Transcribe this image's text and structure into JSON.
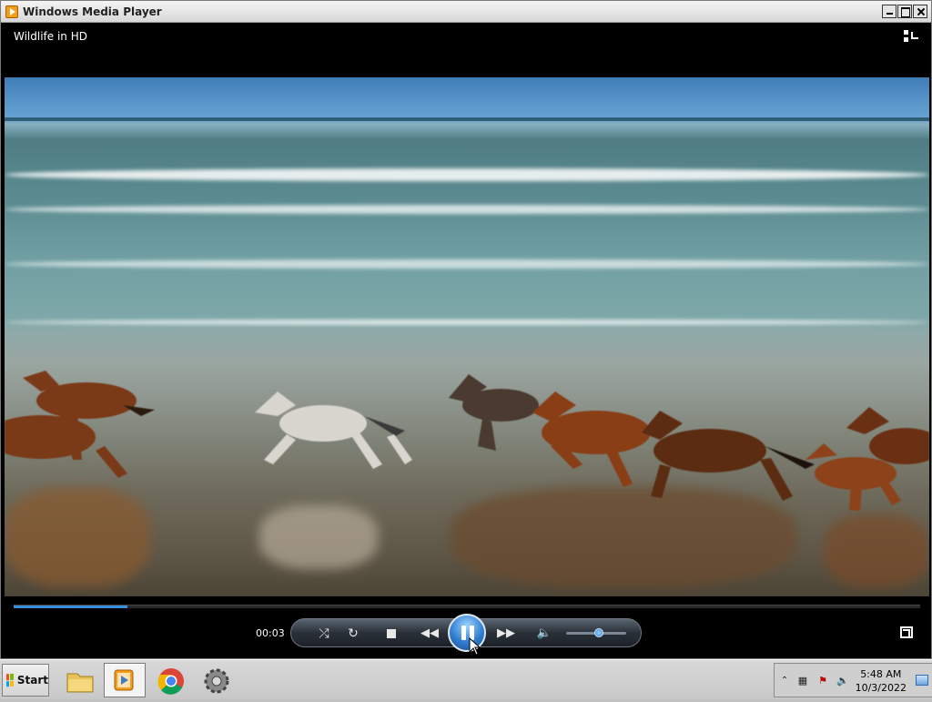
{
  "window": {
    "title": "Windows Media Player",
    "media_title": "Wildlife in HD"
  },
  "player": {
    "elapsed": "00:03",
    "progress": 0.126,
    "volume": 0.55,
    "state": "playing",
    "accent_color": "#3b8fd8"
  },
  "icons": {
    "switch_library": "switch-to-library-icon",
    "shuffle": "shuffle-icon",
    "repeat": "repeat-icon",
    "stop": "stop-icon",
    "previous": "previous-icon",
    "pause": "pause-icon",
    "next": "next-icon",
    "mute": "speaker-icon",
    "fullscreen": "fullscreen-icon"
  },
  "taskbar": {
    "start_label": "Start",
    "apps": [
      {
        "name": "file-explorer"
      },
      {
        "name": "windows-media-player",
        "active": true
      },
      {
        "name": "google-chrome"
      },
      {
        "name": "system-settings"
      }
    ],
    "clock_time": "5:48 AM",
    "clock_date": "10/3/2022"
  }
}
